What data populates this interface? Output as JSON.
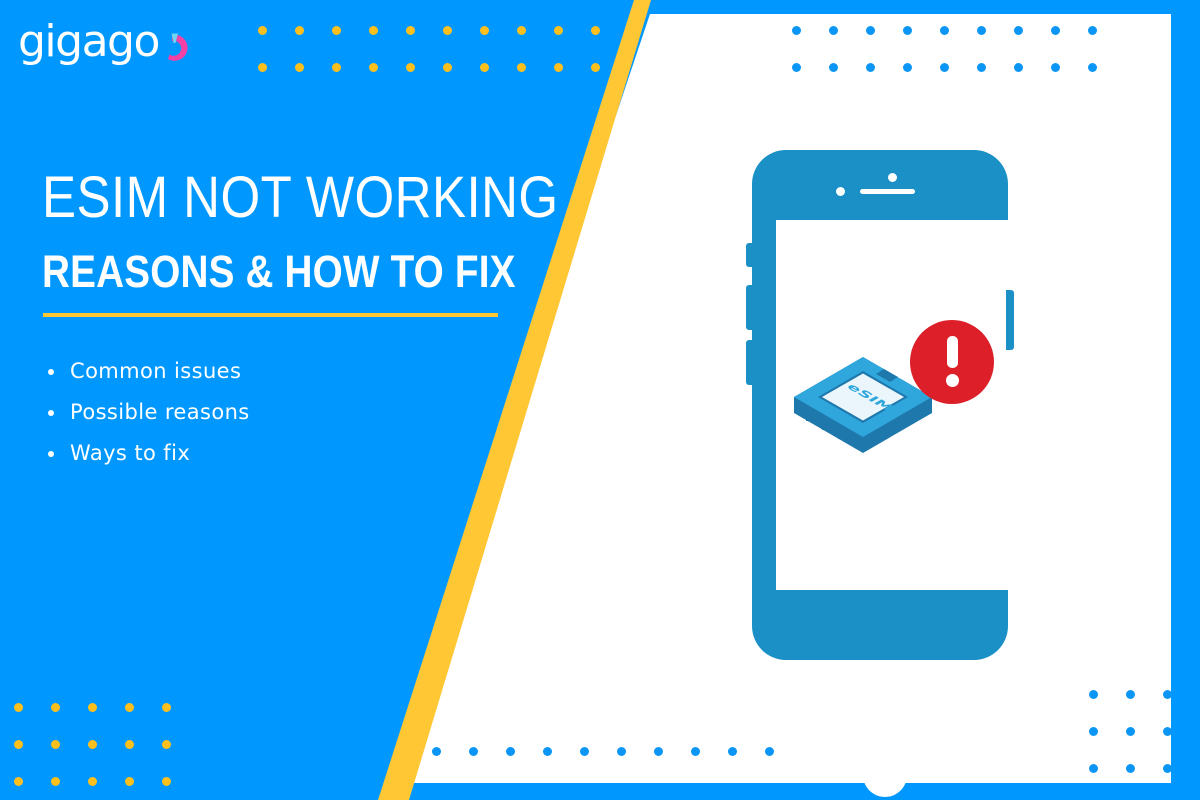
{
  "brand": {
    "logo_text": "gigago",
    "logo_icon": "gauge-arc-icon",
    "accent_pink": "#F441A5",
    "accent_cyan": "#6FD3F2"
  },
  "colors": {
    "background_blue": "#0098FF",
    "panel_white": "#FFFFFF",
    "stripe_yellow": "#FFC734",
    "dot_yellow": "#FFC01E",
    "dot_blue": "#0B96F5",
    "device_blue": "#1B90C6",
    "alert_red": "#DC1F28"
  },
  "headline": {
    "line1": "ESIM NOT WORKING",
    "line2": "REASONS & HOW TO FIX"
  },
  "bullets": [
    {
      "label": "Common issues"
    },
    {
      "label": "Possible reasons"
    },
    {
      "label": "Ways to fix"
    }
  ],
  "illustration": {
    "phone_label": "smartphone-illustration",
    "card_label": "esim-chip-illustration",
    "card_text": "eSIM",
    "alert_label": "error-alert-badge"
  },
  "decor": {
    "top_left_dots": {
      "rows": 2,
      "cols": 10,
      "color": "yellow"
    },
    "top_right_dots": {
      "rows": 2,
      "cols": 9,
      "color": "blue"
    },
    "bottom_left_dots": {
      "rows": 3,
      "cols": 5,
      "color": "yellow"
    },
    "bottom_right_dots": {
      "rows": 3,
      "cols": 3,
      "color": "blue"
    },
    "bottom_center_dots": {
      "rows": 1,
      "cols": 10,
      "color": "blue"
    }
  }
}
